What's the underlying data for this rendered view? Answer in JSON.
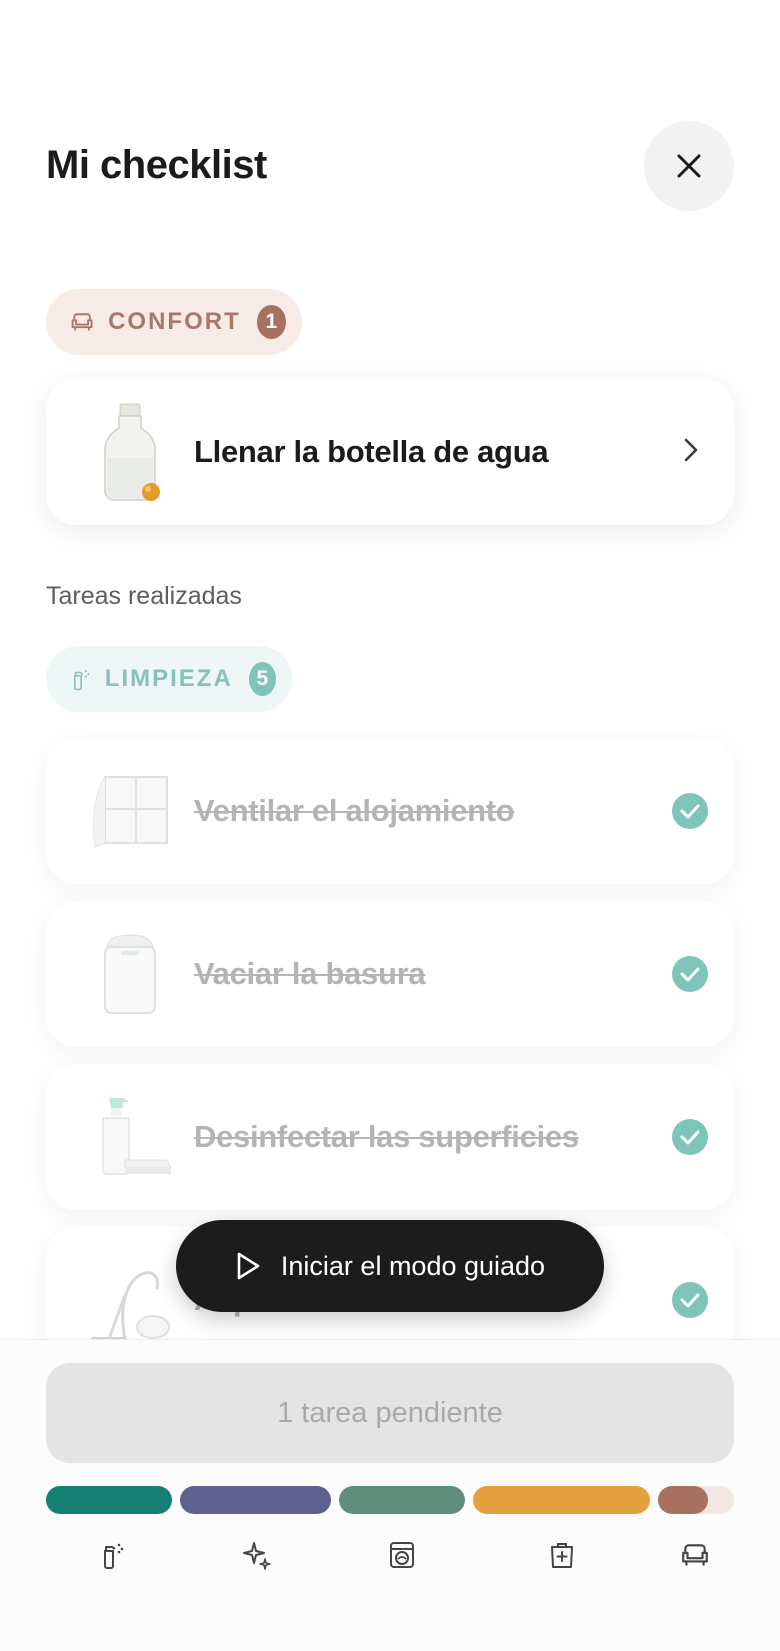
{
  "header": {
    "title": "Mi checklist"
  },
  "pending": {
    "category": {
      "label": "CONFORT",
      "count": "1",
      "icon": "armchair-icon",
      "color": "#a8715f"
    },
    "items": [
      {
        "label": "Llenar la botella de agua",
        "image": "water-bottle"
      }
    ]
  },
  "done": {
    "section_title": "Tareas realizadas",
    "category": {
      "label": "LIMPIEZA",
      "count": "5",
      "icon": "spray-icon",
      "color": "#7fc3b9"
    },
    "items": [
      {
        "label": "Ventilar el alojamiento",
        "image": "window"
      },
      {
        "label": "Vaciar la basura",
        "image": "trash-bin"
      },
      {
        "label": "Desinfectar las superficies",
        "image": "spray-bottle"
      },
      {
        "label": "Aspirar",
        "image": "vacuum-cleaner"
      }
    ]
  },
  "guided_mode": {
    "label": "Iniciar el modo guiado",
    "icon": "play-icon"
  },
  "footer": {
    "pending_label": "1 tarea pendiente",
    "progress_colors": [
      "#157f72",
      "#5f6191",
      "#5f8f7c",
      "#e3a03f",
      "#a8715f",
      "#f3e7e3"
    ],
    "tabs": [
      {
        "icon": "spray-icon"
      },
      {
        "icon": "sparkles-icon"
      },
      {
        "icon": "washing-machine-icon"
      },
      {
        "icon": "first-aid-bag-icon"
      },
      {
        "icon": "armchair-icon"
      }
    ]
  }
}
